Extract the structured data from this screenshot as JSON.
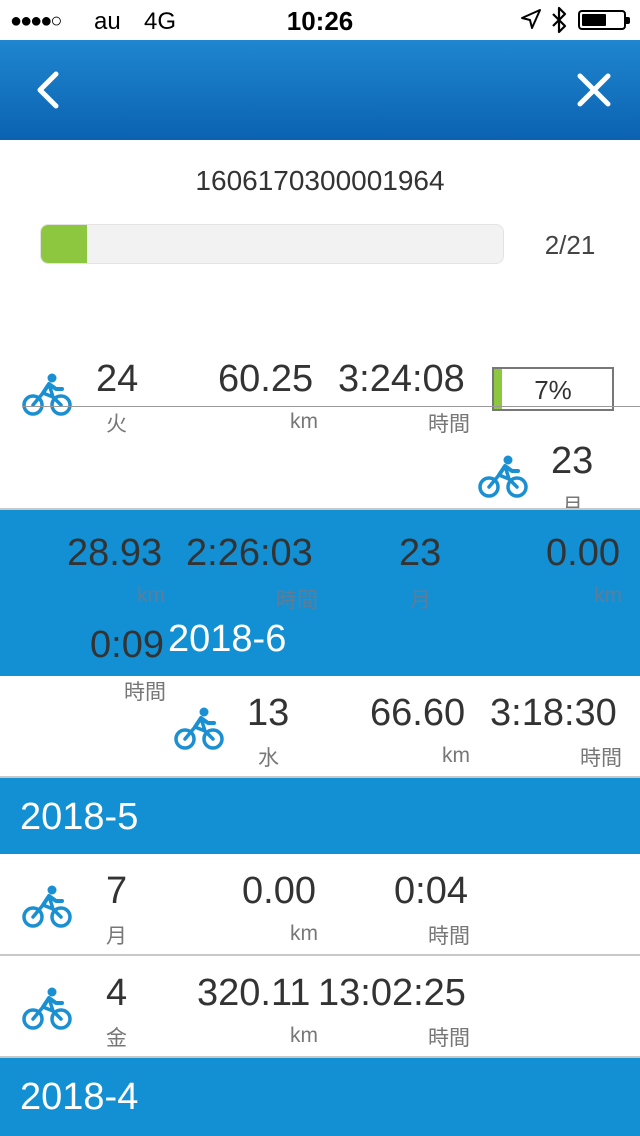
{
  "status_bar": {
    "signal": "●●●●○",
    "carrier": "au",
    "network": "4G",
    "time": "10:26",
    "location_icon": "location-arrow-icon",
    "bluetooth_icon": "bluetooth-icon",
    "battery_level": 0.6
  },
  "header": {
    "back_icon": "chevron-left-icon",
    "close_icon": "close-icon"
  },
  "sync": {
    "device_id": "1606170300001964",
    "progress_fraction": 0.1,
    "progress_count": "2/21"
  },
  "activities": [
    {
      "day": "24",
      "weekday": "火",
      "distance": "60.25",
      "distance_unit": "km",
      "duration": "3:24:08",
      "duration_unit": "時間",
      "upload_percent": "7%",
      "upload_fraction": 0.07
    },
    {
      "day": "23",
      "weekday": "月"
    },
    {
      "distance": "28.93",
      "distance_unit": "km",
      "duration": "2:26:03",
      "duration_unit": "時間",
      "day": "23",
      "weekday": "月",
      "distance2": "0.00",
      "distance2_unit": "km",
      "duration2": "0:09",
      "duration2_unit": "時間"
    },
    {
      "day": "13",
      "weekday": "水",
      "distance": "66.60",
      "distance_unit": "km",
      "duration": "3:18:30",
      "duration_unit": "時間"
    },
    {
      "day": "7",
      "weekday": "月",
      "distance": "0.00",
      "distance_unit": "km",
      "duration": "0:04",
      "duration_unit": "時間"
    },
    {
      "day": "4",
      "weekday": "金",
      "distance": "320.11",
      "distance_unit": "km",
      "duration": "13:02:25",
      "duration_unit": "時間"
    }
  ],
  "months": [
    "2018-6",
    "2018-5",
    "2018-4"
  ],
  "colors": {
    "header": "#0b62b0",
    "band": "#1290d3",
    "progress": "#8dc63f",
    "bike_icon": "#1a8fd1"
  },
  "icons": {
    "activity": "bicycle-icon"
  }
}
